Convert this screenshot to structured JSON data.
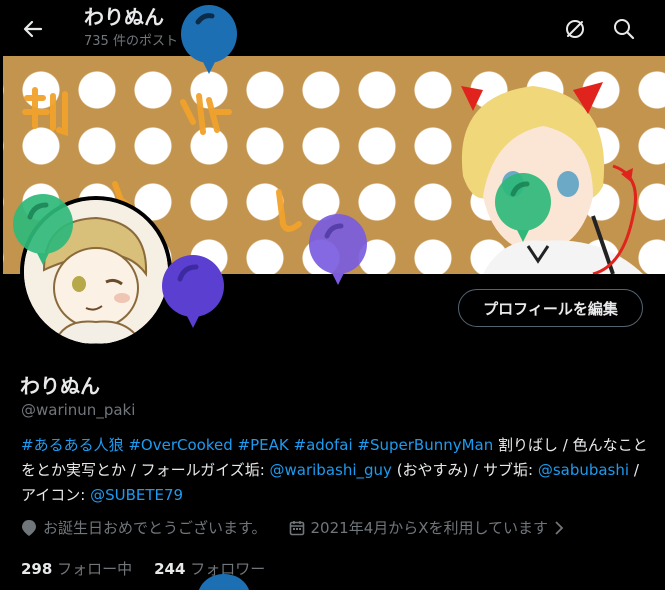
{
  "header": {
    "title": "わりぬん",
    "post_count": "735 件のポスト"
  },
  "profile": {
    "name": "わりぬん",
    "handle": "@warinun_paki",
    "edit_button": "プロフィールを編集"
  },
  "bio": {
    "tag1": "#あるある人狼",
    "tag2": "#OverCooked",
    "tag3": "#PEAK",
    "tag4": "#adofai",
    "tag5": "#SuperBunnyMan",
    "text1": " 割りばし / 色んなことをとか実写とか / フォールガイズ垢: ",
    "mention1": "@waribashi_guy",
    "text2": " (おやすみ) / サブ垢: ",
    "mention2": "@sabubashi",
    "text3": " / アイコン: ",
    "mention3": "@SUBETE79"
  },
  "meta": {
    "birthday": "お誕生日おめでとうございます。",
    "joined": "2021年4月からXを利用しています"
  },
  "stats": {
    "following_count": "298",
    "following_label": "フォロー中",
    "followers_count": "244",
    "followers_label": "フォロワー"
  },
  "colors": {
    "accent": "#1d9bf0",
    "banner_bg": "#c2944e",
    "balloon_blue": "#1d6fb4",
    "balloon_green": "#2fb87a",
    "balloon_purple": "#7b5ce0"
  },
  "icons": [
    "back-arrow-icon",
    "dismiss-circle-icon",
    "search-icon",
    "balloon-icon",
    "location-pin-icon",
    "calendar-icon",
    "chevron-right-icon"
  ]
}
